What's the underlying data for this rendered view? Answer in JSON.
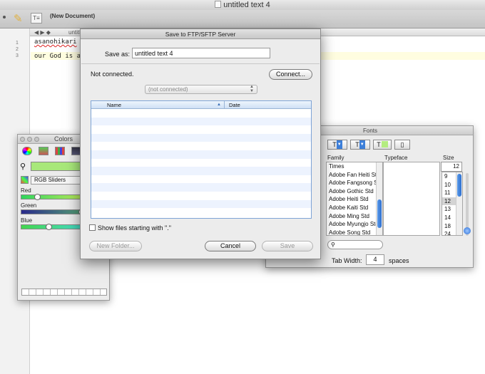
{
  "editor": {
    "title": "untitled text 4",
    "toolbar_doc_label": "(New Document)",
    "nav_arrows": "◀  ▶  ◆",
    "nav_doc": "untitl",
    "line_numbers": [
      "1",
      "2",
      "3"
    ],
    "lines": [
      "asanohikari",
      "",
      "our God is abl"
    ]
  },
  "colors_panel": {
    "title": "Colors",
    "mode": "RGB Sliders",
    "sliders": [
      {
        "label": "Red",
        "value": 0.16
      },
      {
        "label": "Green",
        "value": 0.72
      },
      {
        "label": "Blue",
        "value": 0.31
      }
    ],
    "swatch_color": "#a8e87a"
  },
  "fonts_panel": {
    "title": "Fonts",
    "columns": {
      "family": "Family",
      "typeface": "Typeface",
      "size": "Size"
    },
    "families": [
      "Times",
      "Adobe Fan Heiti Std",
      "Adobe Fangsong Std",
      "Adobe Gothic Std",
      "Adobe Heiti Std",
      "Adobe Kaiti Std",
      "Adobe Ming Std",
      "Adobe Myungjo Std",
      "Adobe Song Std"
    ],
    "sizes": [
      "9",
      "10",
      "11",
      "12",
      "13",
      "14",
      "18",
      "24"
    ],
    "selected_size": "12",
    "size_value": "12",
    "tab_width_label": "Tab Width:",
    "tab_width_value": "4",
    "tab_width_unit": "spaces"
  },
  "save_dialog": {
    "title": "Save to FTP/SFTP Server",
    "save_as_label": "Save as:",
    "save_as_value": "untitled text 4",
    "status": "Not connected.",
    "connect_label": "Connect...",
    "server_select": "(not connected)",
    "columns": {
      "name": "Name",
      "date": "Date"
    },
    "show_hidden_label": "Show files starting with \".\"",
    "new_folder_label": "New Folder...",
    "cancel_label": "Cancel",
    "save_label": "Save"
  }
}
